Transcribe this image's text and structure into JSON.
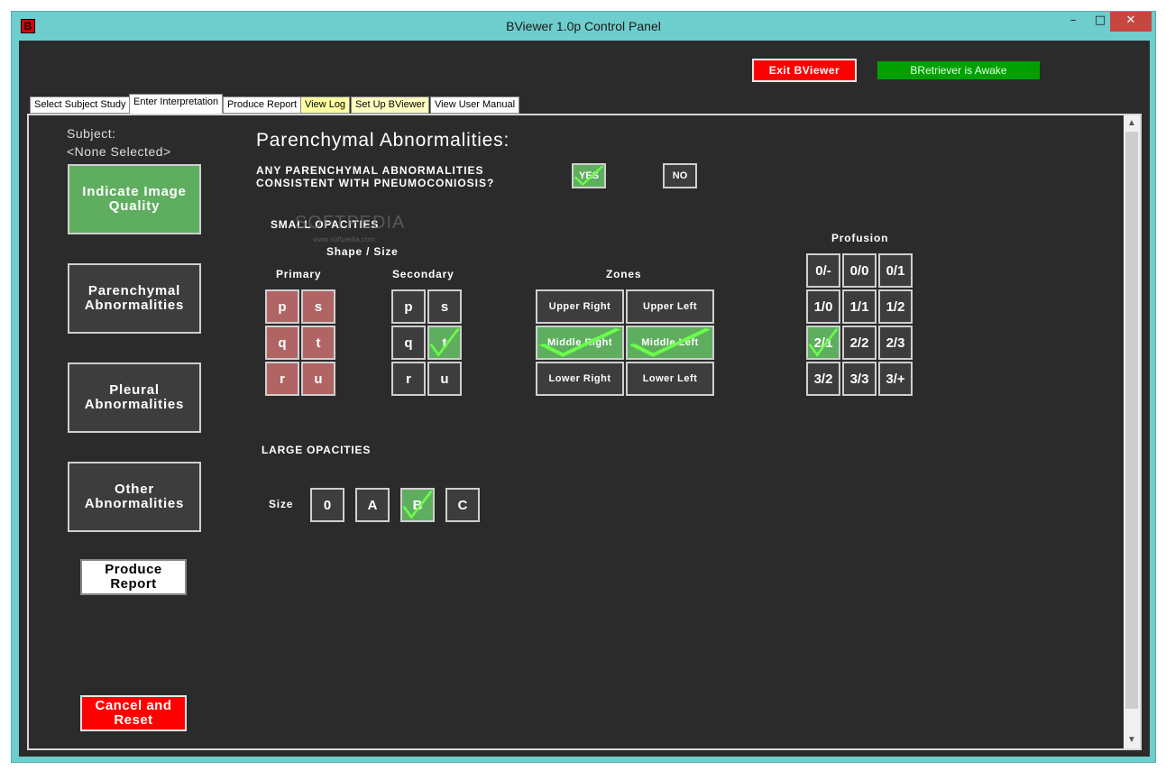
{
  "window": {
    "title": "BViewer 1.0p Control Panel",
    "app_icon_letter": "B",
    "controls": {
      "minimize": "–",
      "maximize": "□",
      "close": "✕"
    }
  },
  "header": {
    "exit_label": "Exit BViewer",
    "status_label": "BRetriever is Awake"
  },
  "tabs": [
    {
      "label": "Select Subject Study",
      "bg": "#ffffff",
      "color": "#000000",
      "active": false
    },
    {
      "label": "Enter Interpretation",
      "bg": "#ffffff",
      "color": "#000000",
      "active": true
    },
    {
      "label": "Produce Report",
      "bg": "#ffffff",
      "color": "#000000",
      "active": false
    },
    {
      "label": "View Log",
      "bg": "#ffffa0",
      "color": "#000000",
      "active": false
    },
    {
      "label": "Set Up BViewer",
      "bg": "#ffffc0",
      "color": "#000000",
      "active": false
    },
    {
      "label": "View User Manual",
      "bg": "#ffffff",
      "color": "#000000",
      "active": false
    }
  ],
  "sidebar": {
    "subject_label": "Subject:",
    "subject_value": "<None Selected>",
    "nav": [
      {
        "label": "Indicate Image Quality",
        "state": "green"
      },
      {
        "label": "Parenchymal Abnormalities",
        "state": "normal"
      },
      {
        "label": "Pleural Abnormalities",
        "state": "normal"
      },
      {
        "label": "Other Abnormalities",
        "state": "normal"
      }
    ],
    "produce_report": "Produce Report",
    "cancel_reset": "Cancel and Reset"
  },
  "main": {
    "title": "Parenchymal Abnormalities:",
    "question": "ANY PARENCHYMAL ABNORMALITIES CONSISTENT WITH PNEUMOCONIOSIS?",
    "yes_label": "YES",
    "no_label": "NO",
    "yes_selected": true,
    "watermark": "SOFTPEDIA",
    "watermark_url": "www.softpedia.com",
    "small_opacities": {
      "heading": "SMALL OPACITIES",
      "shape_size": "Shape / Size",
      "primary_label": "Primary",
      "primary": [
        {
          "label": "p",
          "state": "red"
        },
        {
          "label": "s",
          "state": "red"
        },
        {
          "label": "q",
          "state": "red"
        },
        {
          "label": "t",
          "state": "red"
        },
        {
          "label": "r",
          "state": "red"
        },
        {
          "label": "u",
          "state": "red"
        }
      ],
      "secondary_label": "Secondary",
      "secondary": [
        {
          "label": "p",
          "state": "normal"
        },
        {
          "label": "s",
          "state": "normal"
        },
        {
          "label": "q",
          "state": "normal"
        },
        {
          "label": "t",
          "state": "green"
        },
        {
          "label": "r",
          "state": "normal"
        },
        {
          "label": "u",
          "state": "normal"
        }
      ],
      "zones_label": "Zones",
      "zones": [
        {
          "label": "Upper Right",
          "state": "normal"
        },
        {
          "label": "Upper Left",
          "state": "normal"
        },
        {
          "label": "Middle Right",
          "state": "green"
        },
        {
          "label": "Middle Left",
          "state": "green"
        },
        {
          "label": "Lower Right",
          "state": "normal"
        },
        {
          "label": "Lower Left",
          "state": "normal"
        }
      ],
      "profusion_label": "Profusion",
      "profusion": [
        {
          "label": "0/-",
          "state": "normal"
        },
        {
          "label": "0/0",
          "state": "normal"
        },
        {
          "label": "0/1",
          "state": "normal"
        },
        {
          "label": "1/0",
          "state": "normal"
        },
        {
          "label": "1/1",
          "state": "normal"
        },
        {
          "label": "1/2",
          "state": "normal"
        },
        {
          "label": "2/1",
          "state": "green"
        },
        {
          "label": "2/2",
          "state": "normal"
        },
        {
          "label": "2/3",
          "state": "normal"
        },
        {
          "label": "3/2",
          "state": "normal"
        },
        {
          "label": "3/3",
          "state": "normal"
        },
        {
          "label": "3/+",
          "state": "normal"
        }
      ]
    },
    "large_opacities": {
      "heading": "LARGE OPACITIES",
      "size_label": "Size",
      "sizes": [
        {
          "label": "0",
          "state": "normal"
        },
        {
          "label": "A",
          "state": "normal"
        },
        {
          "label": "B",
          "state": "green"
        },
        {
          "label": "C",
          "state": "normal"
        }
      ]
    }
  },
  "colors": {
    "selected_green": "#5fae5f",
    "primary_red": "#b06464",
    "check_green": "#6bff4a",
    "exit_red": "#ff0000",
    "status_green": "#00a000",
    "frame_teal": "#6ecdcd"
  }
}
